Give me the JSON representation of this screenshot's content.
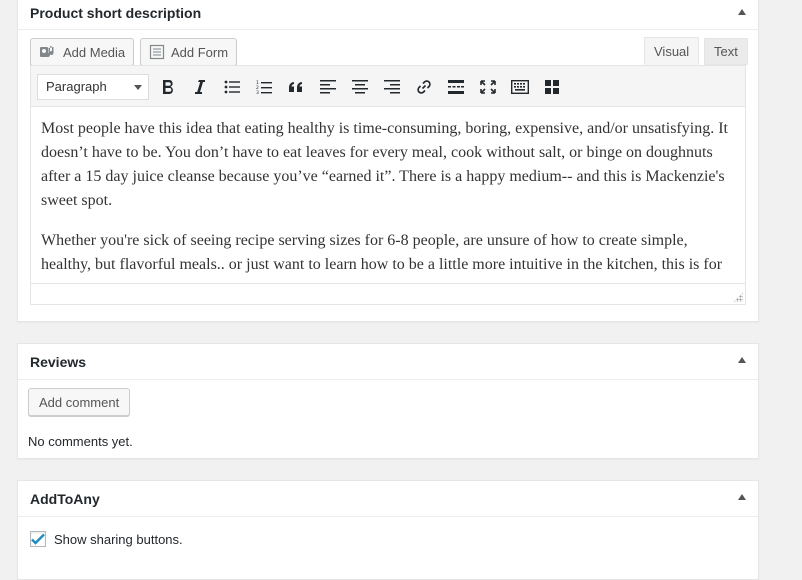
{
  "short_description": {
    "title": "Product short description",
    "add_media_label": "Add Media",
    "add_form_label": "Add Form",
    "tabs": [
      {
        "label": "Visual",
        "active": true
      },
      {
        "label": "Text",
        "active": false
      }
    ],
    "format_select_value": "Paragraph",
    "toolbar_icons": [
      "bold-icon",
      "italic-icon",
      "bullet-list-icon",
      "numbered-list-icon",
      "blockquote-icon",
      "align-left-icon",
      "align-center-icon",
      "align-right-icon",
      "link-icon",
      "read-more-icon",
      "fullscreen-icon",
      "keyboard-icon",
      "toolbar-toggle-icon"
    ],
    "paragraphs": [
      "Most people have this idea that eating healthy is time-consuming, boring, expensive, and/or unsatisfying. It doesn’t have to be. You don’t have to eat leaves for every meal, cook without salt, or binge on doughnuts after a 15 day juice cleanse because you’ve “earned it”. There is a happy medium-- and this is Mackenzie's sweet spot.",
      "Whether you're sick of seeing recipe serving sizes for 6-8 people, are unsure of how to create simple, healthy, but flavorful meals.. or just want to learn how to be a little more intuitive in the kitchen, this is for you."
    ]
  },
  "reviews": {
    "title": "Reviews",
    "add_comment_label": "Add comment",
    "empty_text": "No comments yet."
  },
  "addtoany": {
    "title": "AddToAny",
    "checkbox_label": "Show sharing buttons.",
    "checked": true
  },
  "colors": {
    "checkmark": "#1e8cbe",
    "border": "#e5e5e5",
    "text": "#23282d"
  }
}
